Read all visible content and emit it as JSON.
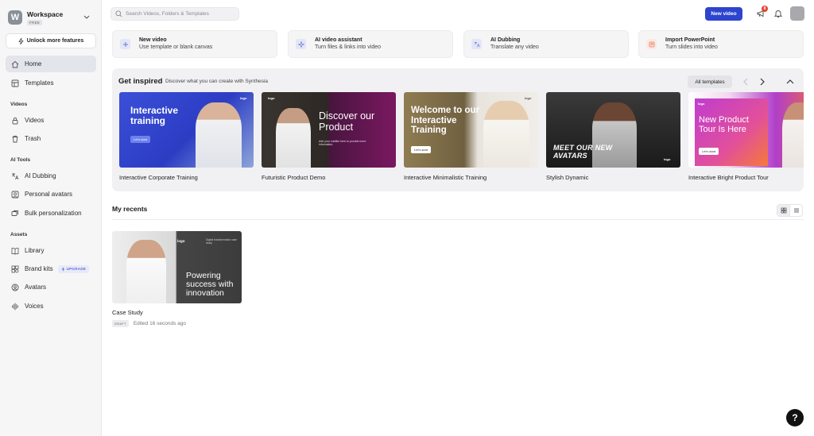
{
  "workspace": {
    "initial": "W",
    "name": "Workspace",
    "plan": "FREE"
  },
  "sidebar": {
    "unlock_label": "Unlock more features",
    "home": "Home",
    "templates": "Templates",
    "section_videos": "Videos",
    "videos": "Videos",
    "trash": "Trash",
    "section_ai_tools": "AI Tools",
    "ai_dubbing": "AI Dubbing",
    "personal_avatars": "Personal avatars",
    "bulk_personalization": "Bulk personalization",
    "section_assets": "Assets",
    "library": "Library",
    "brand_kits": "Brand kits",
    "upgrade_badge": "UPGRADE",
    "avatars": "Avatars",
    "voices": "Voices"
  },
  "topbar": {
    "search_placeholder": "Search Videos, Folders & Templates",
    "new_video": "New video",
    "notification_count": "8"
  },
  "quick_actions": [
    {
      "title": "New video",
      "subtitle": "Use template or blank canvas"
    },
    {
      "title": "AI video assistant",
      "subtitle": "Turn files & links into video"
    },
    {
      "title": "AI Dubbing",
      "subtitle": "Translate any video"
    },
    {
      "title": "Import PowerPoint",
      "subtitle": "Turn slides into video"
    }
  ],
  "inspired": {
    "title": "Get inspired",
    "subtitle": "Discover what you can create with Synthesia",
    "all_templates": "All templates",
    "templates": [
      {
        "name": "Interactive Corporate Training",
        "thumb_text": "Interactive training",
        "cta": "Let's start"
      },
      {
        "name": "Futuristic Product Demo",
        "thumb_text": "Discover our Product",
        "cta": "Add your subtitle here to provide more information."
      },
      {
        "name": "Interactive Minimalistic Training",
        "thumb_text": "Welcome to our Interactive Training",
        "cta": "Let's start"
      },
      {
        "name": "Stylish Dynamic",
        "thumb_text": "MEET OUR NEW AVATARS",
        "cta": ""
      },
      {
        "name": "Interactive Bright Product Tour",
        "thumb_text": "New Product Tour Is Here",
        "cta": "Let's start"
      }
    ],
    "logo_text": "logo"
  },
  "recents": {
    "title": "My recents",
    "items": [
      {
        "name": "Case Study",
        "status": "DRAFT",
        "edited": "Edited 16 seconds ago",
        "thumb_text": "Powering success with innovation",
        "thumb_caption": "Digital transformation case study",
        "logo_text": "logo"
      }
    ]
  },
  "help_label": "?"
}
